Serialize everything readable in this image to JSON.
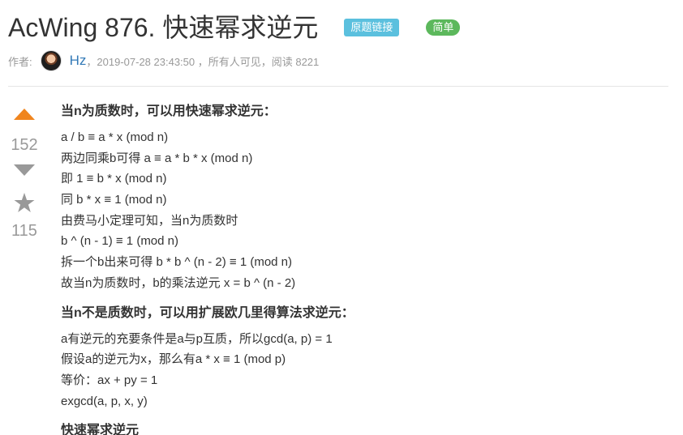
{
  "post": {
    "title": "AcWing 876. 快速幂求逆元",
    "link_tag": "原题链接",
    "difficulty": "简单"
  },
  "meta": {
    "author_label": "作者:",
    "author_name": "Hz",
    "details": "，2019-07-28 23:43:50 ，所有人可见，阅读 8221"
  },
  "votes": {
    "up_count": "152",
    "fav_count": "115"
  },
  "content": {
    "section1": {
      "heading": "当n为质数时，可以用快速幂求逆元：",
      "lines": [
        "a / b ≡ a * x (mod n)",
        "两边同乘b可得 a ≡ a * b * x (mod n)",
        "即 1 ≡ b * x (mod n)",
        "同 b * x ≡ 1 (mod n)",
        "由费马小定理可知，当n为质数时",
        "b ^ (n - 1) ≡ 1 (mod n)",
        "拆一个b出来可得 b * b ^ (n - 2) ≡ 1 (mod n)",
        "故当n为质数时，b的乘法逆元 x = b ^ (n - 2)"
      ]
    },
    "section2": {
      "heading": "当n不是质数时，可以用扩展欧几里得算法求逆元：",
      "lines": [
        "a有逆元的充要条件是a与p互质，所以gcd(a, p) = 1",
        "假设a的逆元为x，那么有a * x ≡ 1 (mod p)",
        "等价：ax + py = 1",
        "exgcd(a, p, x, y)"
      ]
    },
    "section3_heading": "快速幂求逆元"
  },
  "colors": {
    "accent_up": "#f0851e",
    "vote_grey": "#999999",
    "link_tag_bg": "#5bc0de",
    "difficulty_bg": "#5cb85c",
    "author_link": "#337ab7"
  }
}
